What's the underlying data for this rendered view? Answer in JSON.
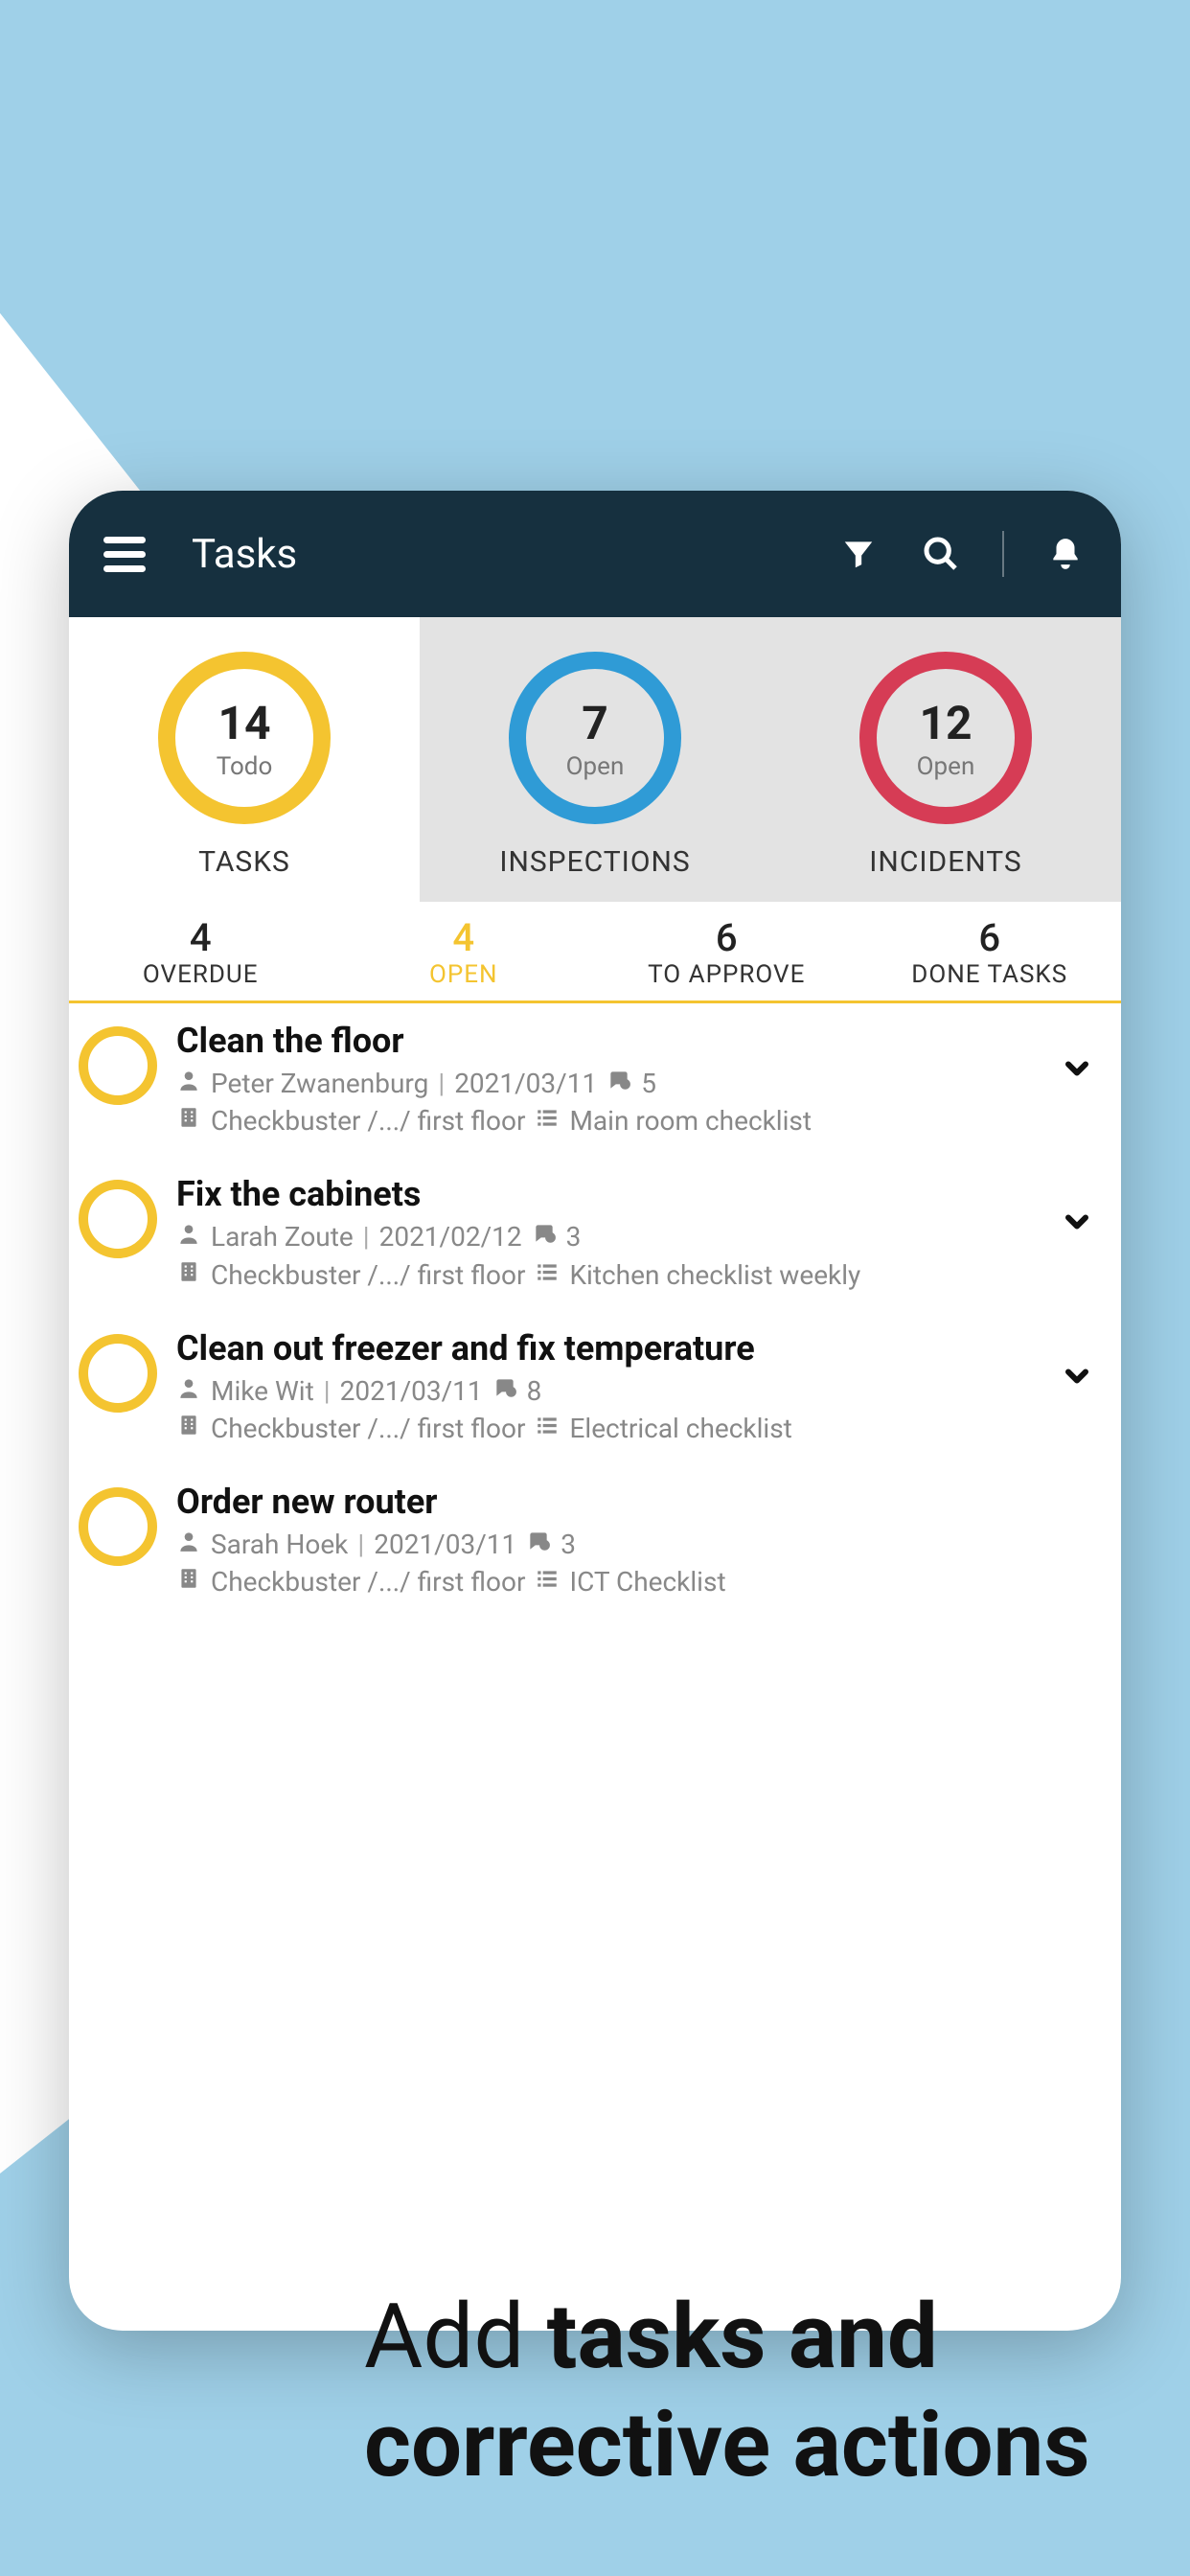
{
  "header": {
    "title": "Tasks"
  },
  "summary": [
    {
      "count": "14",
      "label": "Todo",
      "title": "TASKS",
      "ring": "yellow",
      "active": true
    },
    {
      "count": "7",
      "label": "Open",
      "title": "INSPECTIONS",
      "ring": "blue",
      "active": false
    },
    {
      "count": "12",
      "label": "Open",
      "title": "INCIDENTS",
      "ring": "red",
      "active": false
    }
  ],
  "filters": [
    {
      "count": "4",
      "label": "OVERDUE",
      "active": false
    },
    {
      "count": "4",
      "label": "OPEN",
      "active": true
    },
    {
      "count": "6",
      "label": "TO APPROVE",
      "active": false
    },
    {
      "count": "6",
      "label": "DONE TASKS",
      "active": false
    }
  ],
  "tasks": [
    {
      "title": "Clean the floor",
      "assignee": "Peter Zwanenburg",
      "date": "2021/03/11",
      "comments": "5",
      "path": "Checkbuster /.../ first floor",
      "checklist": "Main room checklist",
      "expandable": true
    },
    {
      "title": "Fix the cabinets",
      "assignee": "Larah Zoute",
      "date": "2021/02/12",
      "comments": "3",
      "path": "Checkbuster /.../ first floor",
      "checklist": "Kitchen checklist weekly",
      "expandable": true
    },
    {
      "title": "Clean out freezer and fix temperature",
      "assignee": "Mike Wit",
      "date": "2021/03/11",
      "comments": "8",
      "path": "Checkbuster /.../ first floor",
      "checklist": "Electrical checklist",
      "expandable": true
    },
    {
      "title": "Order new router",
      "assignee": "Sarah Hoek",
      "date": "2021/03/11",
      "comments": "3",
      "path": "Checkbuster /.../ first floor",
      "checklist": "ICT Checklist",
      "expandable": false
    }
  ],
  "promo": {
    "prefix": "Add ",
    "bold1": "tasks and",
    "bold2": "corrective actions"
  },
  "colors": {
    "headerBg": "#16303f",
    "accentYellow": "#f4c430",
    "accentBlue": "#2f9bd6",
    "accentRed": "#d63c55",
    "bgBlue": "#9fd0e8"
  }
}
